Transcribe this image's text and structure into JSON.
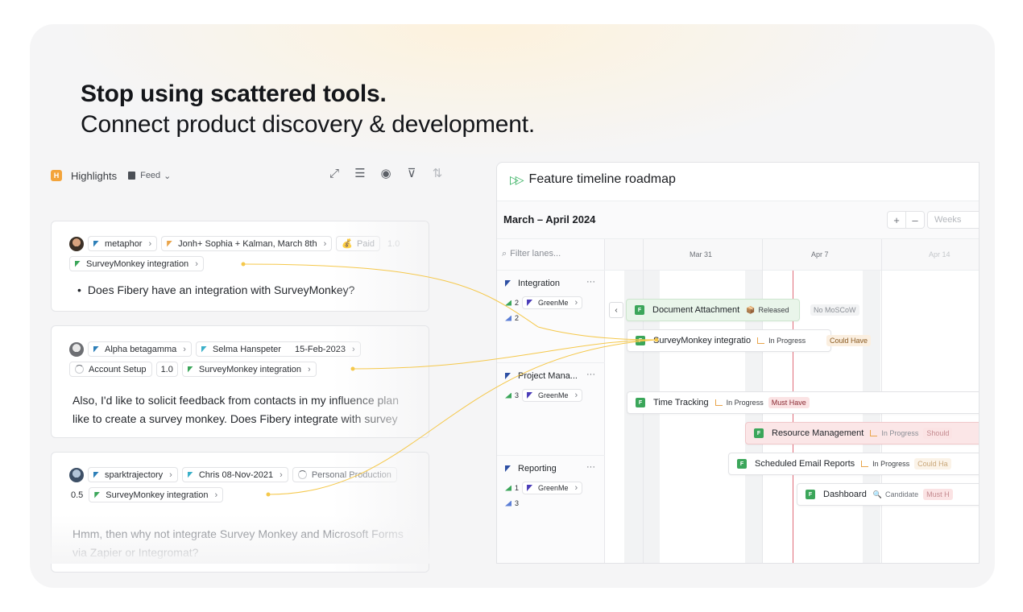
{
  "headline": {
    "line1": "Stop using scattered tools.",
    "line2": "Connect product discovery & development."
  },
  "feed": {
    "title": "Highlights",
    "view": "Feed",
    "posts": [
      {
        "author": "metaphor",
        "source": "Jonh+ Sophia + Kalman, March 8th",
        "status": "Paid",
        "score": "1.0",
        "feature": "SurveyMonkey integration",
        "text": "Does Fibery have an integration with SurveyMonkey?"
      },
      {
        "author": "Alpha betagamma",
        "source": "Selma Hanspeter",
        "date": "15-Feb-2023",
        "account": "Account Setup",
        "score": "1.0",
        "feature": "SurveyMonkey integration",
        "text1": "Also, I'd like to solicit feedback from contacts in my influence plan",
        "text2": "like to create a survey monkey. Does Fibery integrate with survey"
      },
      {
        "author": "sparktrajectory",
        "source": "Chris 08-Nov-2021",
        "category": "Personal Production",
        "score": "0.5",
        "feature": "SurveyMonkey integration",
        "text1": "Hmm, then why not integrate Survey Monkey and Microsoft Forms",
        "text2": "via Zapier or Integromat?"
      }
    ]
  },
  "timeline": {
    "title": "Feature timeline roadmap",
    "range": "March – April 2024",
    "zoom_in": "+",
    "zoom_out": "–",
    "view_mode": "Weeks",
    "filter_placeholder": "Filter lanes...",
    "dates": [
      "Mar 31",
      "Apr 7",
      "Apr 14"
    ],
    "lanes": [
      {
        "name": "Integration",
        "more": "···",
        "count_a": "2",
        "team": "GreenMe",
        "count_b": "2"
      },
      {
        "name": "Project Mana...",
        "more": "···",
        "count_a": "3",
        "team": "GreenMe"
      },
      {
        "name": "Reporting",
        "more": "···",
        "count_a": "1",
        "team": "GreenMe",
        "count_b": "3"
      }
    ],
    "bars": [
      {
        "name": "Document Attachment",
        "status": "Released",
        "priority": "No MoSCoW"
      },
      {
        "name": "SurveyMonkey integratio",
        "status": "In Progress",
        "priority": "Could Have"
      },
      {
        "name": "Time Tracking",
        "status": "In Progress",
        "priority": "Must Have"
      },
      {
        "name": "Resource Management",
        "status": "In Progress",
        "priority": "Should"
      },
      {
        "name": "Scheduled Email Reports",
        "status": "In Progress",
        "priority": "Could Ha"
      },
      {
        "name": "Dashboard",
        "status": "Candidate",
        "priority": "Must H"
      }
    ],
    "feature_badge": "F"
  },
  "colors": {
    "accent_green": "#3ba65a",
    "connector": "#f5c84b",
    "flag_blue": "#2d4fa3",
    "flag_orange": "#e9a44a",
    "today_line": "#e06c7a"
  }
}
